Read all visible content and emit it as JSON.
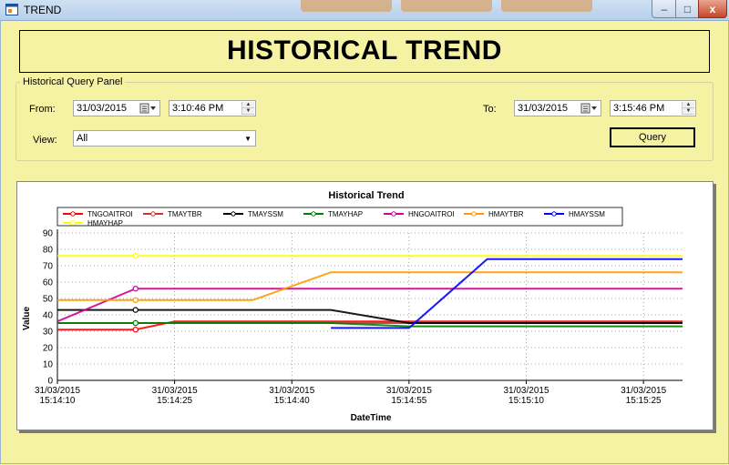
{
  "window": {
    "title": "TREND",
    "controls": {
      "minimize": "–",
      "maximize": "□",
      "close": "x"
    }
  },
  "header": {
    "title": "HISTORICAL TREND"
  },
  "query_panel": {
    "title": "Historical Query Panel",
    "from_label": "From:",
    "from_date": "31/03/2015",
    "from_time": "3:10:46 PM",
    "to_label": "To:",
    "to_date": "31/03/2015",
    "to_time": "3:15:46 PM",
    "view_label": "View:",
    "view_value": "All",
    "query_button": "Query"
  },
  "chart_data": {
    "type": "line",
    "title": "Historical Trend",
    "xlabel": "DateTime",
    "ylabel": "Value",
    "ylim": [
      0,
      90
    ],
    "yticks": [
      0,
      10,
      20,
      30,
      40,
      50,
      60,
      70,
      80,
      90
    ],
    "x": [
      "15:14:10",
      "15:14:15",
      "15:14:20",
      "15:14:25",
      "15:14:30",
      "15:14:35",
      "15:14:40",
      "15:14:45",
      "15:14:50",
      "15:14:55",
      "15:15:00",
      "15:15:05",
      "15:15:10",
      "15:15:15",
      "15:15:20",
      "15:15:25",
      "15:15:30"
    ],
    "xtick_labels": [
      {
        "x": "15:14:10",
        "date": "31/03/2015",
        "time": "15:14:10"
      },
      {
        "x": "15:14:25",
        "date": "31/03/2015",
        "time": "15:14:25"
      },
      {
        "x": "15:14:40",
        "date": "31/03/2015",
        "time": "15:14:40"
      },
      {
        "x": "15:14:55",
        "date": "31/03/2015",
        "time": "15:14:55"
      },
      {
        "x": "15:15:10",
        "date": "31/03/2015",
        "time": "15:15:10"
      },
      {
        "x": "15:15:25",
        "date": "31/03/2015",
        "time": "15:15:25"
      }
    ],
    "grid": true,
    "legend_position": "top",
    "series": [
      {
        "name": "TNGOAITROI",
        "color": "#ff0000",
        "values": [
          31,
          null,
          31,
          36,
          null,
          36,
          null,
          36,
          null,
          36,
          null,
          36,
          null,
          36,
          null,
          36,
          36
        ]
      },
      {
        "name": "TMAYTBR",
        "color": "#c0392b",
        "values": [
          35,
          null,
          35,
          35,
          null,
          35,
          null,
          35,
          null,
          35,
          null,
          35,
          null,
          35,
          null,
          35,
          35
        ]
      },
      {
        "name": "TMAYSSM",
        "color": "#000000",
        "values": [
          43,
          null,
          43,
          43,
          null,
          43,
          null,
          43,
          null,
          35,
          null,
          35,
          null,
          35,
          null,
          35,
          35
        ]
      },
      {
        "name": "TMAYHAP",
        "color": "#008000",
        "values": [
          35,
          null,
          35,
          35,
          null,
          35,
          null,
          35,
          null,
          33,
          null,
          33,
          null,
          33,
          null,
          33,
          33
        ]
      },
      {
        "name": "HNGOAITROI",
        "color": "#cc0099",
        "values": [
          36,
          null,
          56,
          56,
          null,
          56,
          null,
          56,
          null,
          56,
          null,
          56,
          null,
          56,
          null,
          56,
          56
        ]
      },
      {
        "name": "HMAYTBR",
        "color": "#ff9900",
        "values": [
          49,
          null,
          49,
          49,
          null,
          49,
          null,
          66,
          null,
          66,
          null,
          66,
          null,
          66,
          null,
          66,
          66
        ]
      },
      {
        "name": "HMAYSSM",
        "color": "#0000ff",
        "values": [
          null,
          null,
          null,
          null,
          null,
          null,
          null,
          32,
          null,
          32,
          null,
          74,
          null,
          74,
          null,
          74,
          74
        ]
      },
      {
        "name": "HMAYHAP",
        "color": "#ffff00",
        "values": [
          76,
          null,
          76,
          76,
          null,
          76,
          null,
          76,
          null,
          76,
          null,
          76,
          null,
          76,
          null,
          76,
          76
        ]
      }
    ]
  }
}
